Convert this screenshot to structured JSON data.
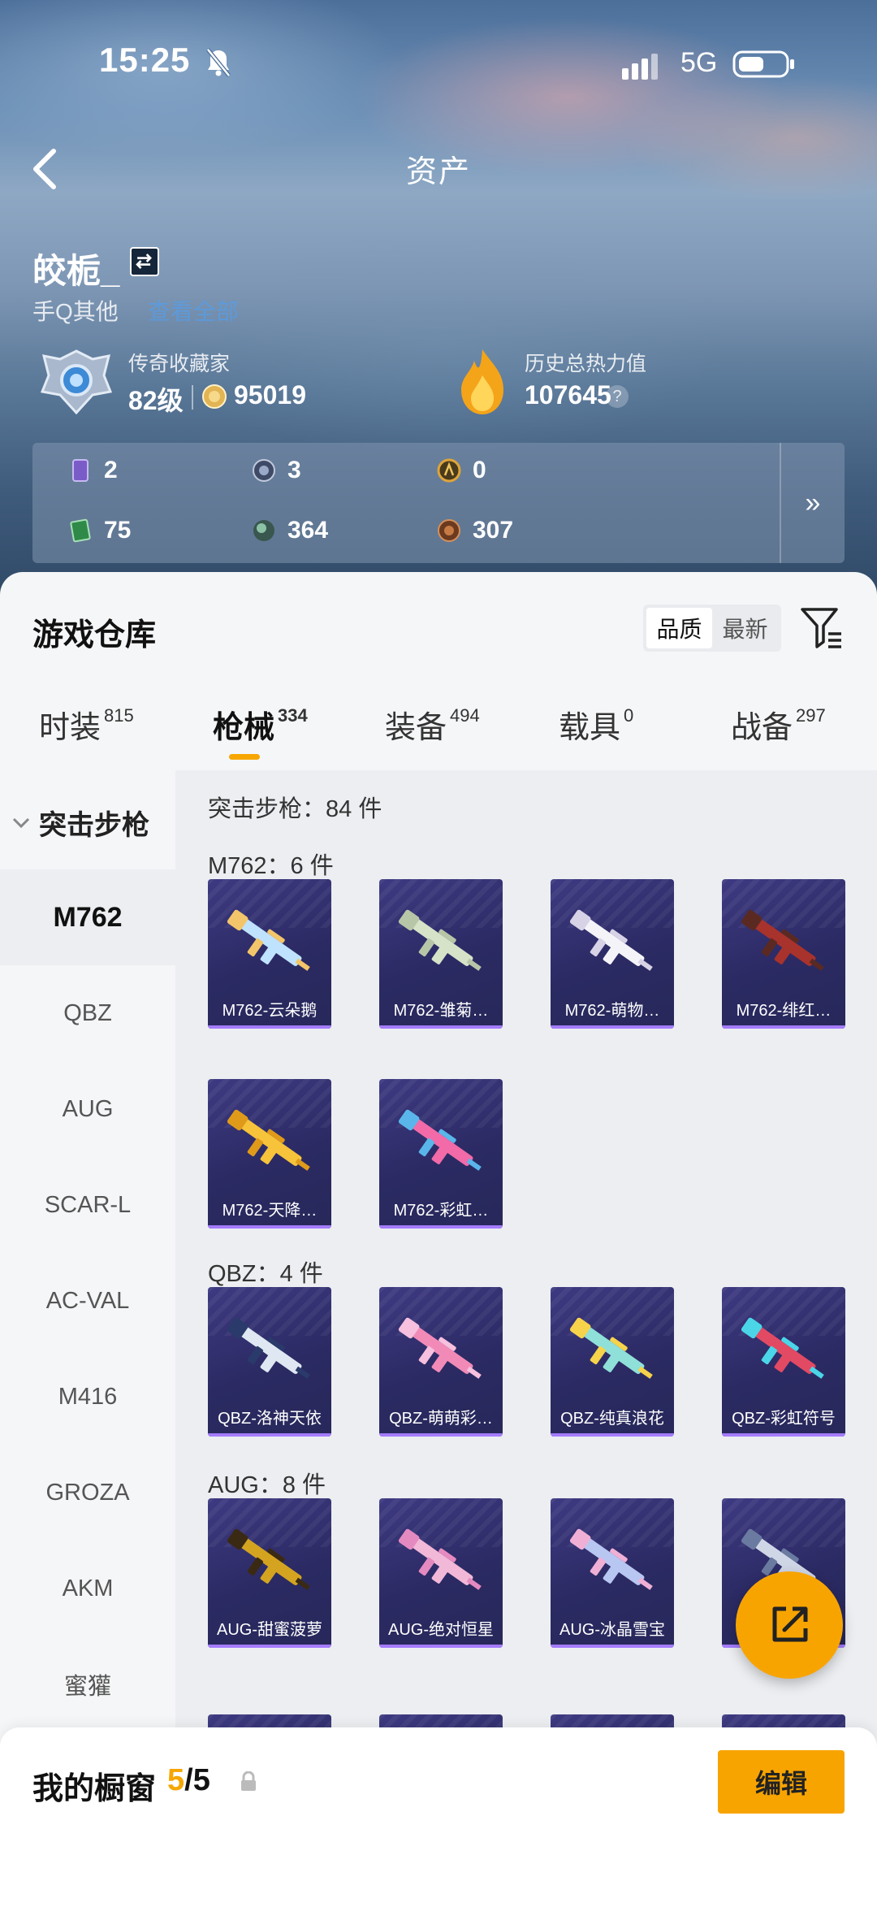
{
  "status_bar": {
    "time": "15:25",
    "network": "5G"
  },
  "header": {
    "title": "资产",
    "back_icon": "chevron-left-icon"
  },
  "profile": {
    "username": "皎栀_",
    "platform": "手Q其他",
    "platform_link": "查看全部",
    "rank_title": "传奇收藏家",
    "level": "82级",
    "coins": "95019",
    "heat_title": "历史总热力值",
    "heat_value": "107645",
    "help": "?"
  },
  "currencies": [
    {
      "icon": "card-icon",
      "value": "2",
      "color": "#7a5cc8"
    },
    {
      "icon": "token-s-icon",
      "value": "3",
      "color": "#6a7cb0"
    },
    {
      "icon": "token-a-icon",
      "value": "0",
      "color": "#e0a43a"
    },
    {
      "icon": "ticket-icon",
      "value": "75",
      "color": "#3fa35a"
    },
    {
      "icon": "sphere-icon",
      "value": "364",
      "color": "#6c9a8a"
    },
    {
      "icon": "bronze-icon",
      "value": "307",
      "color": "#b06a3a"
    }
  ],
  "currency_expand": "»",
  "warehouse": {
    "title": "游戏仓库",
    "sort": [
      "品质",
      "最新"
    ],
    "tabs": [
      {
        "label": "时装",
        "count": "815"
      },
      {
        "label": "枪械",
        "count": "334"
      },
      {
        "label": "装备",
        "count": "494"
      },
      {
        "label": "载具",
        "count": "0"
      },
      {
        "label": "战备",
        "count": "297"
      }
    ],
    "active_tab": 1,
    "category": "突击步枪",
    "side_items": [
      "M762",
      "QBZ",
      "AUG",
      "SCAR-L",
      "AC-VAL",
      "M416",
      "GROZA",
      "AKM",
      "蜜獾"
    ],
    "category_count": "突击步枪：84 件",
    "groups": [
      {
        "title": "M762：6 件",
        "items": [
          "M762-云朵鹅",
          "M762-雏菊…",
          "M762-萌物…",
          "M762-绯红…",
          "M762-天降…",
          "M762-彩虹…"
        ]
      },
      {
        "title": "QBZ：4 件",
        "items": [
          "QBZ-洛神天依",
          "QBZ-萌萌彩…",
          "QBZ-纯真浪花",
          "QBZ-彩虹符号"
        ]
      },
      {
        "title": "AUG：8 件",
        "items": [
          "AUG-甜蜜菠萝",
          "AUG-绝对恒星",
          "AUG-冰晶雪宝",
          "AUG-…"
        ]
      }
    ]
  },
  "showcase": {
    "title": "我的橱窗",
    "current": "5",
    "total": "/5",
    "edit": "编辑"
  }
}
